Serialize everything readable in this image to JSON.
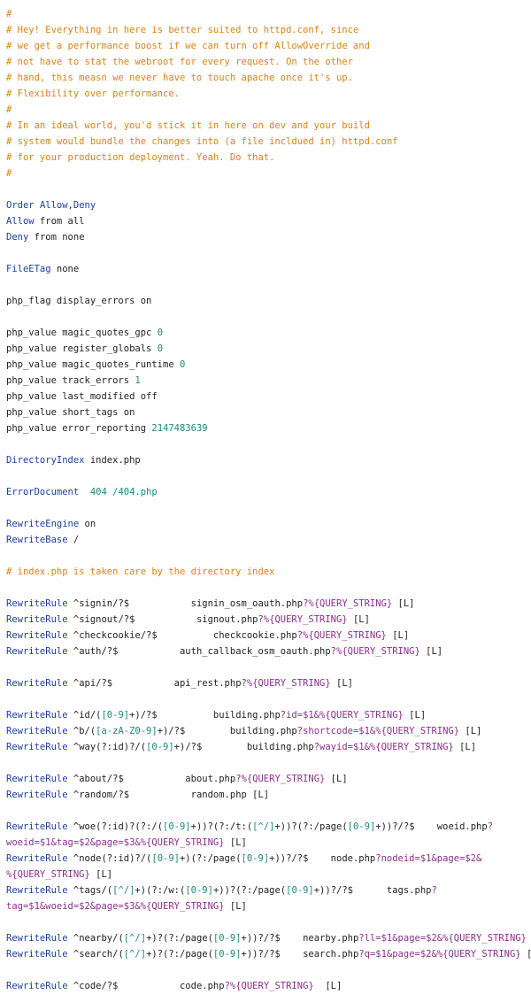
{
  "lines": [
    [
      [
        "c",
        "#"
      ]
    ],
    [
      [
        "c",
        "# Hey! Everything in here is better suited to httpd.conf, since"
      ]
    ],
    [
      [
        "c",
        "# we get a performance boost if we can turn off AllowOverride and"
      ]
    ],
    [
      [
        "c",
        "# not have to stat the webroot for every request. On the other"
      ]
    ],
    [
      [
        "c",
        "# hand, this measn we never have to touch apache once it's up."
      ]
    ],
    [
      [
        "c",
        "# Flexibility over performance."
      ]
    ],
    [
      [
        "c",
        "#"
      ]
    ],
    [
      [
        "c",
        "# In an ideal world, you'd stick it in here on dev and your build"
      ]
    ],
    [
      [
        "c",
        "# system would bundle the changes into (a file incldued in) httpd.conf"
      ]
    ],
    [
      [
        "c",
        "# for your production deployment. Yeah. Do that."
      ]
    ],
    [
      [
        "c",
        "#"
      ]
    ],
    [],
    [
      [
        "k",
        "Order"
      ],
      [
        "t",
        " "
      ],
      [
        "k",
        "Allow,Deny"
      ]
    ],
    [
      [
        "k",
        "Allow"
      ],
      [
        "t",
        " from all"
      ]
    ],
    [
      [
        "k",
        "Deny"
      ],
      [
        "t",
        " from none"
      ]
    ],
    [],
    [
      [
        "k",
        "FileETag"
      ],
      [
        "t",
        " none"
      ]
    ],
    [],
    [
      [
        "t",
        "php_flag display_errors on"
      ]
    ],
    [],
    [
      [
        "t",
        "php_value magic_quotes_gpc "
      ],
      [
        "n",
        "0"
      ]
    ],
    [
      [
        "t",
        "php_value register_globals "
      ],
      [
        "n",
        "0"
      ]
    ],
    [
      [
        "t",
        "php_value magic_quotes_runtime "
      ],
      [
        "n",
        "0"
      ]
    ],
    [
      [
        "t",
        "php_value track_errors "
      ],
      [
        "n",
        "1"
      ]
    ],
    [
      [
        "t",
        "php_value last_modified off"
      ]
    ],
    [
      [
        "t",
        "php_value short_tags on"
      ]
    ],
    [
      [
        "t",
        "php_value error_reporting "
      ],
      [
        "n",
        "2147483639"
      ]
    ],
    [],
    [
      [
        "k",
        "DirectoryIndex"
      ],
      [
        "t",
        " index.php"
      ]
    ],
    [],
    [
      [
        "k",
        "ErrorDocument"
      ],
      [
        "t",
        "  "
      ],
      [
        "n",
        "404"
      ],
      [
        "t",
        " "
      ],
      [
        "v",
        "/404.php"
      ]
    ],
    [],
    [
      [
        "k",
        "RewriteEngine"
      ],
      [
        "t",
        " on"
      ]
    ],
    [
      [
        "k",
        "RewriteBase"
      ],
      [
        "t",
        " /"
      ]
    ],
    [],
    [
      [
        "c",
        "# index.php is taken care by the directory index"
      ]
    ],
    [],
    [
      [
        "k",
        "RewriteRule"
      ],
      [
        "t",
        " ^signin/?$           signin_osm_oauth.php"
      ],
      [
        "r",
        "?%{QUERY_STRING}"
      ],
      [
        "t",
        " [L]"
      ]
    ],
    [
      [
        "k",
        "RewriteRule"
      ],
      [
        "t",
        " ^signout/?$           signout.php"
      ],
      [
        "r",
        "?%{QUERY_STRING}"
      ],
      [
        "t",
        " [L]"
      ]
    ],
    [
      [
        "k",
        "RewriteRule"
      ],
      [
        "t",
        " ^checkcookie/?$          checkcookie.php"
      ],
      [
        "r",
        "?%{QUERY_STRING}"
      ],
      [
        "t",
        " [L]"
      ]
    ],
    [
      [
        "k",
        "RewriteRule"
      ],
      [
        "t",
        " ^auth/?$           auth_callback_osm_oauth.php"
      ],
      [
        "r",
        "?%{QUERY_STRING}"
      ],
      [
        "t",
        " [L]"
      ]
    ],
    [],
    [
      [
        "k",
        "RewriteRule"
      ],
      [
        "t",
        " ^api/?$           api_rest.php"
      ],
      [
        "r",
        "?%{QUERY_STRING}"
      ],
      [
        "t",
        " [L]"
      ]
    ],
    [],
    [
      [
        "k",
        "RewriteRule"
      ],
      [
        "t",
        " ^id/("
      ],
      [
        "v",
        "[0-9]"
      ],
      [
        "t",
        "+)/?$          building.php"
      ],
      [
        "r",
        "?id=$1&%{QUERY_STRING}"
      ],
      [
        "t",
        " [L]"
      ]
    ],
    [
      [
        "k",
        "RewriteRule"
      ],
      [
        "t",
        " ^b/("
      ],
      [
        "v",
        "[a-zA-Z0-9]"
      ],
      [
        "t",
        "+)/?$        building.php"
      ],
      [
        "r",
        "?shortcode=$1&%{QUERY_STRING}"
      ],
      [
        "t",
        " [L]"
      ]
    ],
    [
      [
        "k",
        "RewriteRule"
      ],
      [
        "t",
        " ^way(?:id)?/("
      ],
      [
        "v",
        "[0-9]"
      ],
      [
        "t",
        "+)/?$        building.php"
      ],
      [
        "r",
        "?wayid=$1&%{QUERY_STRING}"
      ],
      [
        "t",
        " [L]"
      ]
    ],
    [],
    [
      [
        "k",
        "RewriteRule"
      ],
      [
        "t",
        " ^about/?$           about.php"
      ],
      [
        "r",
        "?%{QUERY_STRING}"
      ],
      [
        "t",
        " [L]"
      ]
    ],
    [
      [
        "k",
        "RewriteRule"
      ],
      [
        "t",
        " ^random/?$           random.php [L]"
      ]
    ],
    [],
    [
      [
        "k",
        "RewriteRule"
      ],
      [
        "t",
        " ^woe(?:id)?(?:/("
      ],
      [
        "v",
        "[0-9]"
      ],
      [
        "t",
        "+))?(?:/t:("
      ],
      [
        "v",
        "[^/]"
      ],
      [
        "t",
        "+))?(?:/page("
      ],
      [
        "v",
        "[0-9]"
      ],
      [
        "t",
        "+))?/?$    woeid.php"
      ],
      [
        "r",
        "?"
      ]
    ],
    [
      [
        "r",
        "woeid=$1&tag=$2&page=$3&%{QUERY_STRING}"
      ],
      [
        "t",
        " [L]"
      ]
    ],
    [
      [
        "k",
        "RewriteRule"
      ],
      [
        "t",
        " ^node(?:id)?/("
      ],
      [
        "v",
        "[0-9]"
      ],
      [
        "t",
        "+)(?:/page("
      ],
      [
        "v",
        "[0-9]"
      ],
      [
        "t",
        "+))?/?$    node.php"
      ],
      [
        "r",
        "?nodeid=$1&page=$2&"
      ]
    ],
    [
      [
        "r",
        "%{QUERY_STRING}"
      ],
      [
        "t",
        " [L]"
      ]
    ],
    [
      [
        "k",
        "RewriteRule"
      ],
      [
        "t",
        " ^tags/("
      ],
      [
        "v",
        "[^/]"
      ],
      [
        "t",
        "+)(?:/w:("
      ],
      [
        "v",
        "[0-9]"
      ],
      [
        "t",
        "+))?(?:/page("
      ],
      [
        "v",
        "[0-9]"
      ],
      [
        "t",
        "+))?/?$      tags.php"
      ],
      [
        "r",
        "?"
      ]
    ],
    [
      [
        "r",
        "tag=$1&woeid=$2&page=$3&%{QUERY_STRING}"
      ],
      [
        "t",
        " [L]"
      ]
    ],
    [],
    [
      [
        "k",
        "RewriteRule"
      ],
      [
        "t",
        " ^nearby/("
      ],
      [
        "v",
        "[^/]"
      ],
      [
        "t",
        "+)?(?:/page("
      ],
      [
        "v",
        "[0-9]"
      ],
      [
        "t",
        "+))?/?$    nearby.php"
      ],
      [
        "r",
        "?ll=$1&page=$2&%{QUERY_STRING}"
      ],
      [
        "t",
        " [L]"
      ]
    ],
    [
      [
        "k",
        "RewriteRule"
      ],
      [
        "t",
        " ^search/("
      ],
      [
        "v",
        "[^/]"
      ],
      [
        "t",
        "+)?(?:/page("
      ],
      [
        "v",
        "[0-9]"
      ],
      [
        "t",
        "+))?/?$    search.php"
      ],
      [
        "r",
        "?q=$1&page=$2&%{QUERY_STRING}"
      ],
      [
        "t",
        " [L]"
      ]
    ],
    [],
    [
      [
        "k",
        "RewriteRule"
      ],
      [
        "t",
        " ^code/?$           code.php"
      ],
      [
        "r",
        "?%{QUERY_STRING}"
      ],
      [
        "t",
        "  [L]"
      ]
    ]
  ],
  "colors": {
    "comment": "#d9840f",
    "directive": "#1c3f9e",
    "value": "#1a8a7a",
    "query": "#8a2f8f",
    "text": "#222222",
    "background": "#ffffff"
  }
}
